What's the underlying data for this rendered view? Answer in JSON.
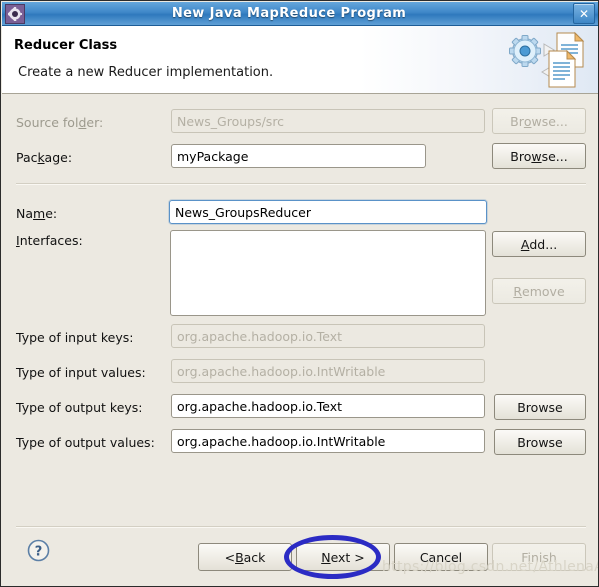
{
  "window": {
    "title": "New Java MapReduce Program",
    "app_icon": "gear-icon",
    "close_label": "✕"
  },
  "header": {
    "title": "Reducer Class",
    "subtitle": "Create a new Reducer implementation.",
    "graphic": "gear-and-documents-icon"
  },
  "form": {
    "source_folder": {
      "label_pre": "Source fol",
      "label_mnemonic": "d",
      "label_post": "er:",
      "value": "News_Groups/src",
      "disabled": true,
      "button_pre": "Br",
      "button_mnemonic": "o",
      "button_post": "wse...",
      "button_disabled": true
    },
    "package": {
      "label_pre": "Pac",
      "label_mnemonic": "k",
      "label_post": "age:",
      "value": "myPackage",
      "disabled": false,
      "button_pre": "Bro",
      "button_mnemonic": "w",
      "button_post": "se...",
      "button_disabled": false
    },
    "name": {
      "label_pre": "Na",
      "label_mnemonic": "m",
      "label_post": "e:",
      "value": "News_GroupsReducer",
      "focused": true
    },
    "interfaces": {
      "label_pre": "",
      "label_mnemonic": "I",
      "label_post": "nterfaces:",
      "items": [],
      "add_pre": "",
      "add_mnemonic": "A",
      "add_post": "dd...",
      "remove_pre": "",
      "remove_mnemonic": "R",
      "remove_post": "emove",
      "remove_disabled": true
    },
    "type_input_keys": {
      "label": "Type of input keys:",
      "value": "org.apache.hadoop.io.Text",
      "disabled": true
    },
    "type_input_values": {
      "label": "Type of input values:",
      "value": "org.apache.hadoop.io.IntWritable",
      "disabled": true
    },
    "type_output_keys": {
      "label": "Type of output keys:",
      "value": "org.apache.hadoop.io.Text",
      "disabled": false,
      "button_label": "Browse"
    },
    "type_output_values": {
      "label": "Type of output values:",
      "value": "org.apache.hadoop.io.IntWritable",
      "disabled": false,
      "button_label": "Browse"
    }
  },
  "footer": {
    "help_icon": "question-mark-icon",
    "back": {
      "pre": "< ",
      "mnemonic": "B",
      "post": "ack",
      "disabled": false
    },
    "next": {
      "pre": "",
      "mnemonic": "N",
      "post": "ext >",
      "disabled": false
    },
    "cancel": {
      "label": "Cancel",
      "disabled": false
    },
    "finish": {
      "label": "Finish",
      "disabled": true
    }
  },
  "annotation": {
    "highlight_target": "next-button",
    "highlight_color": "#2b2bc4"
  },
  "watermark": {
    "text": "https://blog.csdn.net/AthlenaA"
  }
}
